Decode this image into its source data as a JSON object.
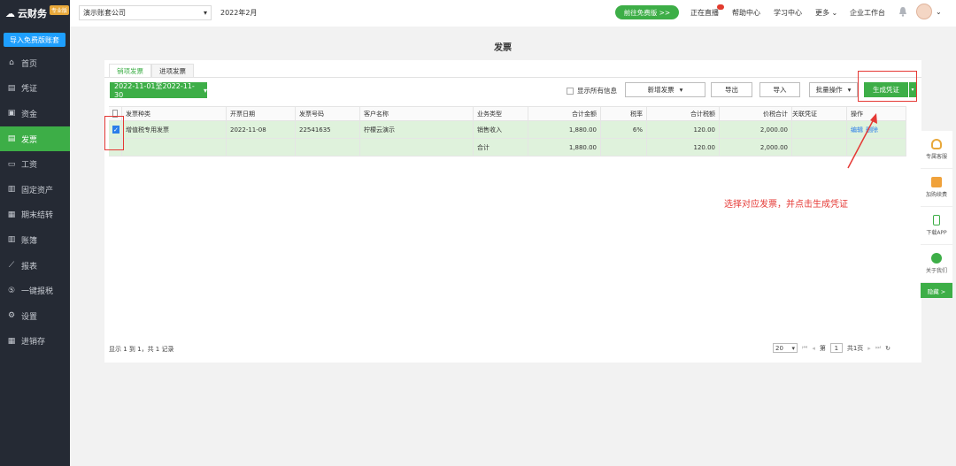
{
  "sidebar": {
    "logo_text": "云财务",
    "logo_badge": "专业版",
    "import_button": "导入免费版账套",
    "items": [
      {
        "label": "首页",
        "icon": "home-icon",
        "glyph": "⌂"
      },
      {
        "label": "凭证",
        "icon": "voucher-icon",
        "glyph": "▤"
      },
      {
        "label": "资金",
        "icon": "fund-icon",
        "glyph": "▣"
      },
      {
        "label": "发票",
        "icon": "invoice-icon",
        "glyph": "▤"
      },
      {
        "label": "工资",
        "icon": "salary-icon",
        "glyph": "▭"
      },
      {
        "label": "固定资产",
        "icon": "asset-icon",
        "glyph": "▥"
      },
      {
        "label": "期末结转",
        "icon": "closing-icon",
        "glyph": "▦"
      },
      {
        "label": "账簿",
        "icon": "ledger-icon",
        "glyph": "▥"
      },
      {
        "label": "报表",
        "icon": "report-icon",
        "glyph": "⟋"
      },
      {
        "label": "一键报税",
        "icon": "tax-icon",
        "glyph": "⑤"
      },
      {
        "label": "设置",
        "icon": "settings-icon",
        "glyph": "⚙"
      },
      {
        "label": "进销存",
        "icon": "inventory-icon",
        "glyph": "▦"
      }
    ],
    "active_index": 3
  },
  "header": {
    "company": "演示账套公司",
    "period": "2022年2月",
    "free_button": "前往免费版 >>",
    "links": [
      "正在直播",
      "帮助中心",
      "学习中心",
      "更多",
      "企业工作台"
    ]
  },
  "page": {
    "title": "发票",
    "tabs": [
      "销项发票",
      "进项发票"
    ],
    "date_range": "2022-11-01至2022-11-30",
    "show_all_label": "显示所有信息",
    "buttons": {
      "add_invoice": "新增发票",
      "export": "导出",
      "import": "导入",
      "batch": "批量操作",
      "generate": "生成凭证"
    }
  },
  "table": {
    "columns": [
      "发票种类",
      "开票日期",
      "发票号码",
      "客户名称",
      "业务类型",
      "合计金额",
      "税率",
      "合计税额",
      "价税合计",
      "关联凭证",
      "操作"
    ],
    "rows": [
      {
        "type": "增值税专用发票",
        "date": "2022-11-08",
        "number": "22541635",
        "customer": "柠檬云演示",
        "biz": "销售收入",
        "amount": "1,880.00",
        "rate": "6%",
        "tax": "120.00",
        "total": "2,000.00",
        "voucher": "",
        "edit": "编辑",
        "delete": "删除",
        "checked": true
      }
    ],
    "summary": {
      "biz": "合计",
      "amount": "1,880.00",
      "tax": "120.00",
      "total": "2,000.00"
    }
  },
  "footer": {
    "info": "显示 1 到 1，共 1 记录",
    "page_size": "20",
    "page_label": "第",
    "page_number": "1",
    "total_pages": "共1页"
  },
  "annotation": "选择对应发票，并点击生成凭证",
  "float_bar": {
    "items": [
      "专属客服",
      "加购续费",
      "下载APP",
      "关于我们"
    ],
    "hide": "隐藏 >"
  },
  "colors": {
    "brand_green": "#3dae47",
    "sidebar_bg": "#252a34",
    "annotation_red": "#e53935",
    "link_blue": "#2b7de9"
  }
}
